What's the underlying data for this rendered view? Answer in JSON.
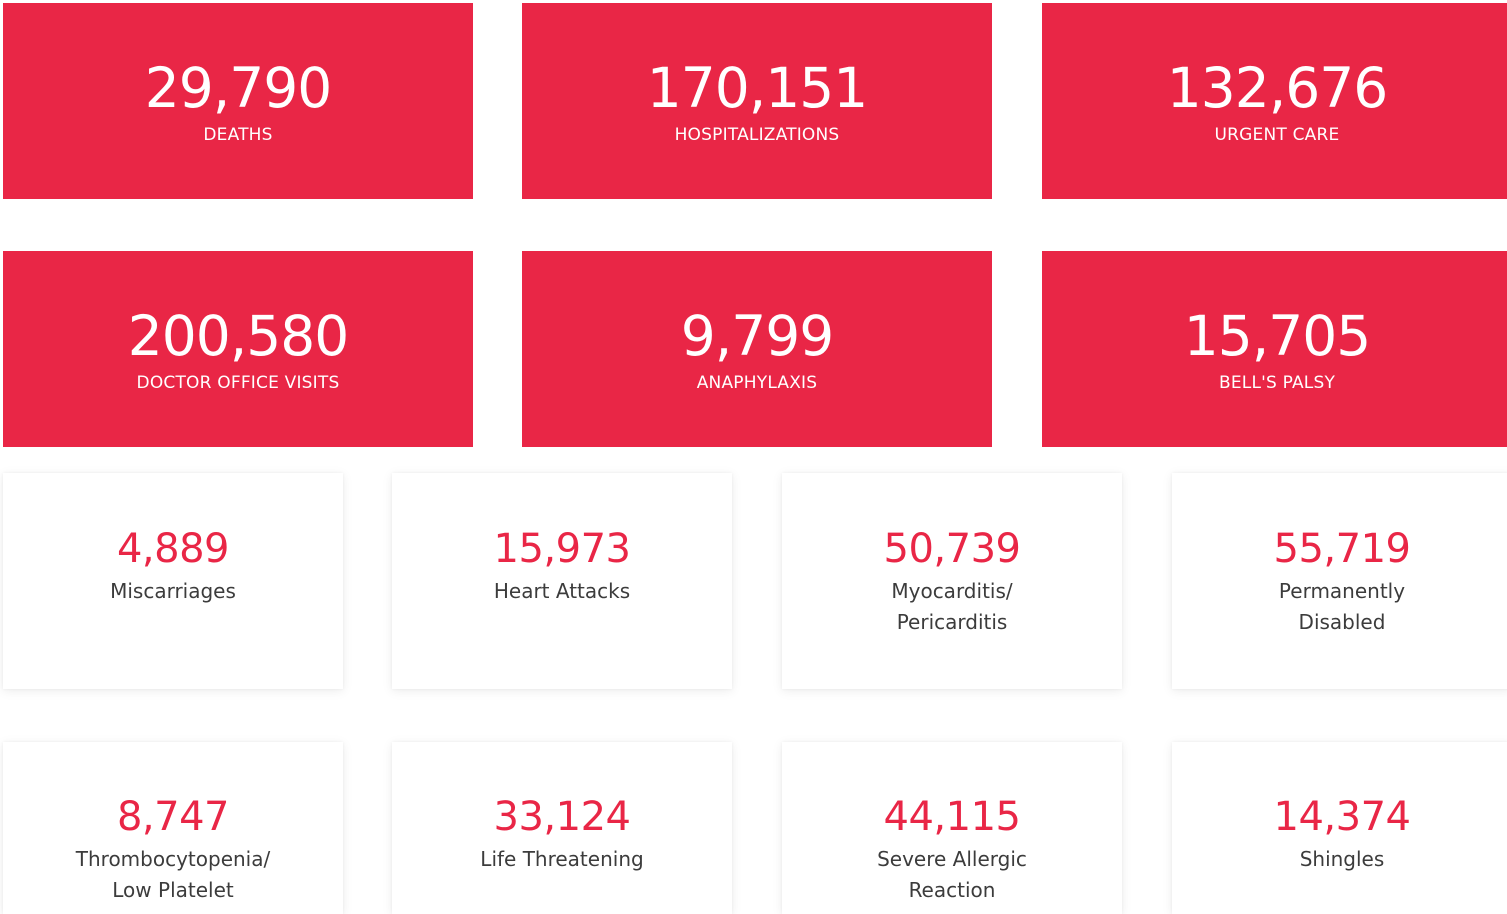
{
  "stats_primary": [
    {
      "value": "29,790",
      "label": "DEATHS"
    },
    {
      "value": "170,151",
      "label": "HOSPITALIZATIONS"
    },
    {
      "value": "132,676",
      "label": "URGENT CARE"
    },
    {
      "value": "200,580",
      "label": "DOCTOR OFFICE VISITS"
    },
    {
      "value": "9,799",
      "label": "ANAPHYLAXIS"
    },
    {
      "value": "15,705",
      "label": "BELL'S PALSY"
    }
  ],
  "stats_secondary": [
    {
      "value": "4,889",
      "label_line1": "Miscarriages",
      "label_line2": ""
    },
    {
      "value": "15,973",
      "label_line1": "Heart Attacks",
      "label_line2": ""
    },
    {
      "value": "50,739",
      "label_line1": "Myocarditis/",
      "label_line2": "Pericarditis"
    },
    {
      "value": "55,719",
      "label_line1": "Permanently",
      "label_line2": "Disabled"
    },
    {
      "value": "8,747",
      "label_line1": "Thrombocytopenia/",
      "label_line2": "Low Platelet"
    },
    {
      "value": "33,124",
      "label_line1": "Life Threatening",
      "label_line2": ""
    },
    {
      "value": "44,115",
      "label_line1": "Severe Allergic",
      "label_line2": "Reaction"
    },
    {
      "value": "14,374",
      "label_line1": "Shingles",
      "label_line2": ""
    }
  ],
  "colors": {
    "accent": "#e92646",
    "card_background": "#ffffff",
    "label_text": "#3c3c3c"
  }
}
